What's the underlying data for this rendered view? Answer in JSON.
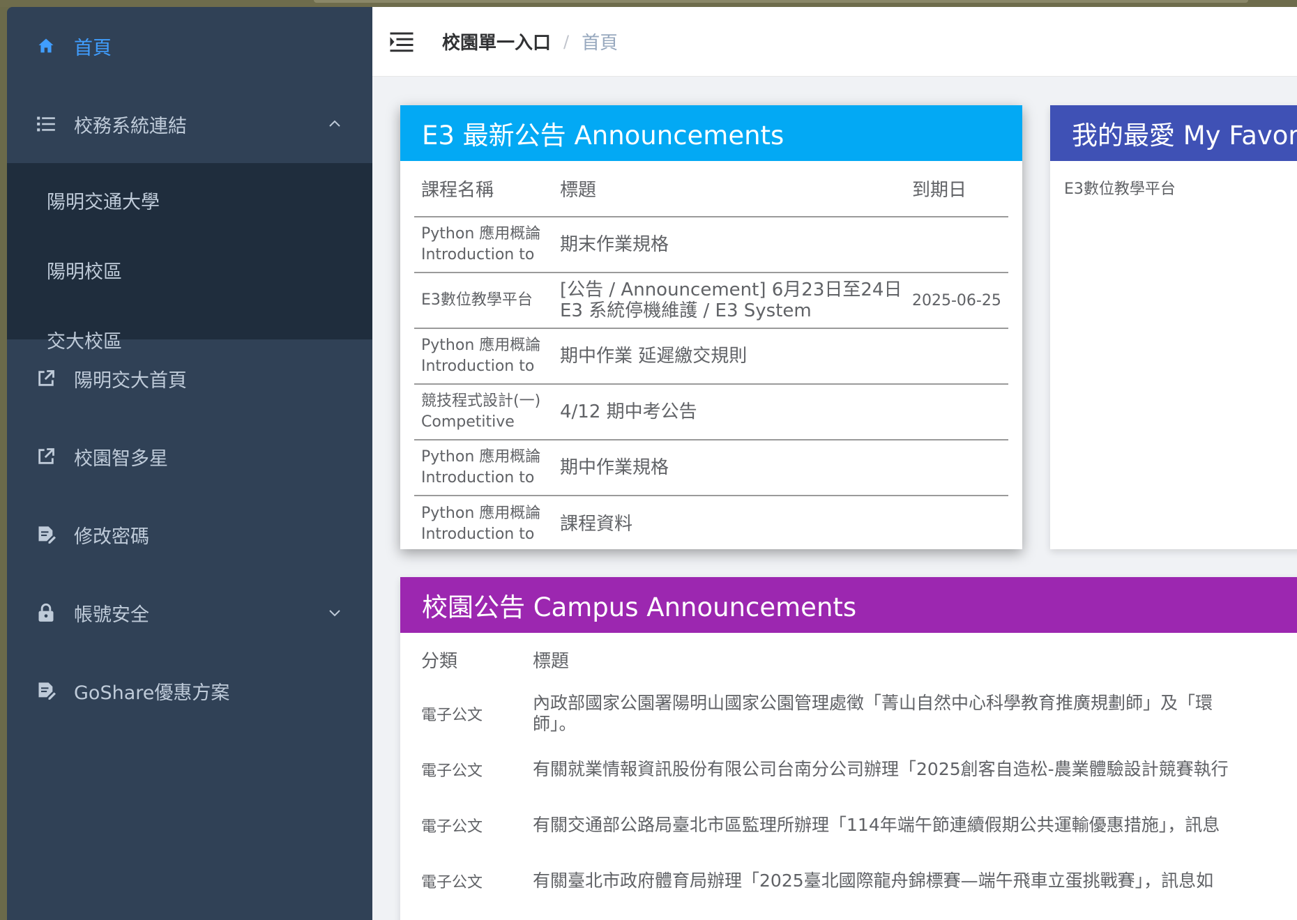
{
  "sidebar": {
    "home": "首頁",
    "school_links": "校務系統連結",
    "sub_items": [
      "陽明交通大學",
      "陽明校區",
      "交大校區"
    ],
    "nycu_home": "陽明交大首頁",
    "campus_star": "校園智多星",
    "change_password": "修改密碼",
    "account_security": "帳號安全",
    "goshare": "GoShare優惠方案"
  },
  "navbar": {
    "breadcrumb_root": "校園單一入口",
    "breadcrumb_sep": "/",
    "breadcrumb_current": "首頁"
  },
  "e3": {
    "title": "E3 最新公告 Announcements",
    "headers": {
      "course": "課程名稱",
      "title": "標題",
      "due": "到期日"
    },
    "rows": [
      {
        "course": "Python 應用概論 Introduction to",
        "title": "期末作業規格",
        "due": ""
      },
      {
        "course": "E3數位教學平台",
        "title": "[公告 / Announcement] 6月23日至24日 E3 系統停機維護 / E3 System",
        "due": "2025-06-25"
      },
      {
        "course": "Python 應用概論 Introduction to",
        "title": "期中作業 延遲繳交規則",
        "due": ""
      },
      {
        "course": "競技程式設計(一) Competitive",
        "title": "4/12 期中考公告",
        "due": ""
      },
      {
        "course": "Python 應用概論 Introduction to",
        "title": "期中作業規格",
        "due": ""
      },
      {
        "course": "Python 應用概論 Introduction to",
        "title": "課程資料",
        "due": ""
      }
    ]
  },
  "favorites": {
    "title": "我的最愛 My Favor",
    "items": [
      "E3數位教學平台"
    ]
  },
  "campus": {
    "title": "校園公告 Campus Announcements",
    "headers": {
      "category": "分類",
      "title": "標題"
    },
    "rows": [
      {
        "category": "電子公文",
        "title": "內政部國家公園署陽明山國家公園管理處徵「菁山自然中心科學教育推廣規劃師」及「環",
        "title2": "師」。"
      },
      {
        "category": "電子公文",
        "title": "有關就業情報資訊股份有限公司台南分公司辦理「2025創客自造松-農業體驗設計競賽執行"
      },
      {
        "category": "電子公文",
        "title": "有關交通部公路局臺北市區監理所辦理「114年端午節連續假期公共運輸優惠措施」，訊息"
      },
      {
        "category": "電子公文",
        "title": "有關臺北市政府體育局辦理「2025臺北國際龍舟錦標賽—端午飛車立蛋挑戰賽」，訊息如"
      }
    ]
  }
}
